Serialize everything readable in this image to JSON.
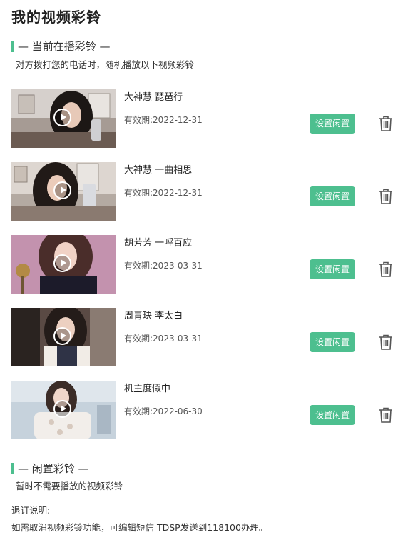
{
  "page": {
    "title": "我的视频彩铃"
  },
  "current": {
    "title": "— 当前在播彩铃 —",
    "desc": "对方拨打您的电话时，随机播放以下视频彩铃",
    "items": [
      {
        "name": "大神慧 琵琶行",
        "validity": "有效期:2022-12-31",
        "button": "设置闲置"
      },
      {
        "name": "大神慧 一曲相思",
        "validity": "有效期:2022-12-31",
        "button": "设置闲置"
      },
      {
        "name": "胡芳芳 一呼百应",
        "validity": "有效期:2023-03-31",
        "button": "设置闲置"
      },
      {
        "name": "周青玦 李太白",
        "validity": "有效期:2023-03-31",
        "button": "设置闲置"
      },
      {
        "name": "机主度假中",
        "validity": "有效期:2022-06-30",
        "button": "设置闲置"
      }
    ]
  },
  "idle": {
    "title": "— 闲置彩铃 —",
    "desc": "暂时不需要播放的视频彩铃"
  },
  "notes": {
    "title": "退订说明:",
    "text": "如需取消视频彩铃功能，可编辑短信 TDSP发送到118100办理。"
  },
  "colors": {
    "accent": "#4dbf8f"
  }
}
